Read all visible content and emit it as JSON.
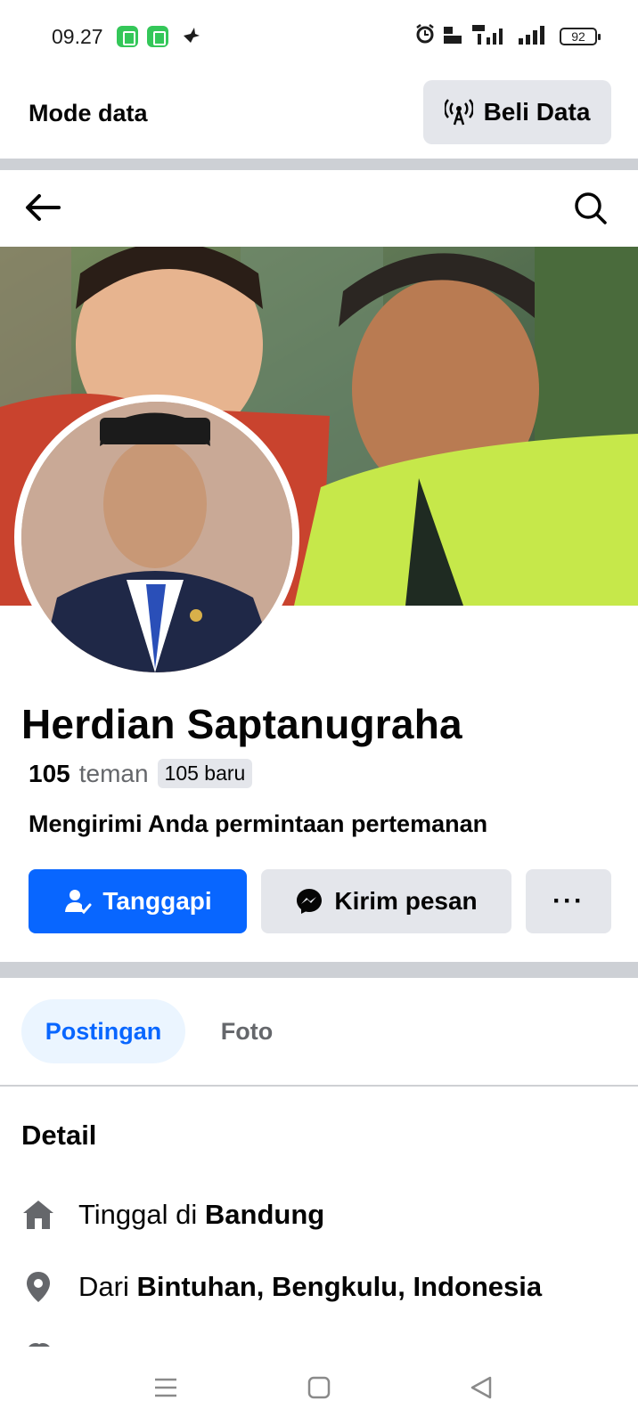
{
  "status_bar": {
    "time": "09.27",
    "battery": "92"
  },
  "data_bar": {
    "mode_label": "Mode data",
    "buy_label": "Beli Data"
  },
  "profile": {
    "name": "Herdian Saptanugraha",
    "friend_count": "105",
    "friend_word": "teman",
    "friend_badge": "105 baru",
    "request_text": "Mengirimi Anda permintaan pertemanan"
  },
  "actions": {
    "respond_label": "Tanggapi",
    "message_label": "Kirim pesan",
    "more_label": "···"
  },
  "tabs": [
    {
      "label": "Postingan",
      "active": true
    },
    {
      "label": "Foto",
      "active": false
    }
  ],
  "details": {
    "heading": "Detail",
    "lives_prefix": "Tinggal di",
    "lives_value": "Bandung",
    "from_prefix": "Dari",
    "from_value": "Bintuhan, Bengkulu, Indonesia"
  },
  "colors": {
    "primary_blue": "#0866ff",
    "button_gray": "#e4e6eb",
    "divider_gray": "#cdd0d5",
    "secondary_text": "#65676b"
  },
  "icons": {
    "back": "arrow-left-icon",
    "search": "search-icon",
    "broadcast": "broadcast-tower-icon",
    "respond": "person-check-icon",
    "messenger": "messenger-icon",
    "home": "home-icon",
    "location": "location-pin-icon"
  }
}
